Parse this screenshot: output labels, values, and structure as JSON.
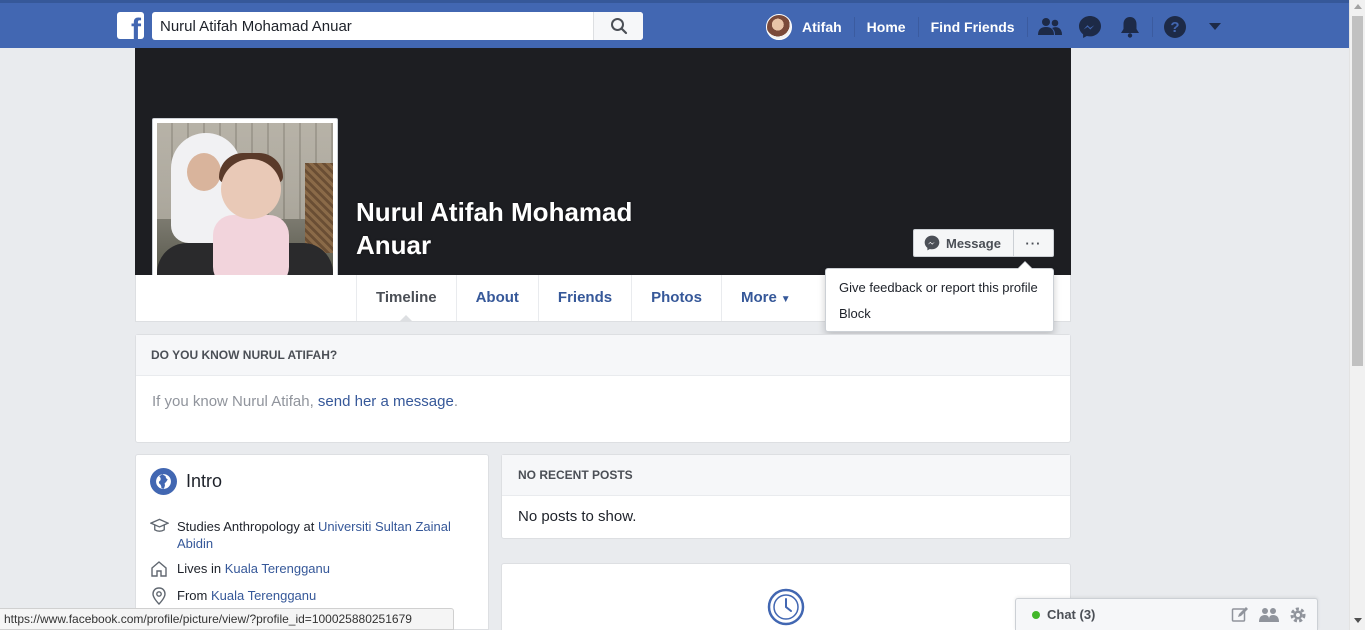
{
  "topbar": {
    "logo": "f",
    "search_value": "Nurul Atifah Mohamad Anuar",
    "user_name": "Atifah",
    "home": "Home",
    "find_friends": "Find Friends",
    "icons": [
      "friend-requests-icon",
      "messenger-icon",
      "notifications-icon",
      "help-icon",
      "account-menu-icon"
    ],
    "color": "#4267b2"
  },
  "profile": {
    "name": "Nurul Atifah Mohamad Anuar",
    "message_button": "Message",
    "more_button": "···"
  },
  "tabs": [
    {
      "label": "Timeline",
      "active": true
    },
    {
      "label": "About"
    },
    {
      "label": "Friends"
    },
    {
      "label": "Photos"
    },
    {
      "label": "More"
    }
  ],
  "dropdown": {
    "items": [
      "Give feedback or report this profile",
      "Block"
    ]
  },
  "know": {
    "heading": "DO YOU KNOW NURUL ATIFAH?",
    "text_prefix": "If you know Nurul Atifah, ",
    "link": "send her a message",
    "text_suffix": "."
  },
  "intro": {
    "title": "Intro",
    "studies_prefix": "Studies Anthropology at ",
    "studies_link": "Universiti Sultan Zainal Abidin",
    "lives_prefix": "Lives in ",
    "lives_link": "Kuala Terengganu",
    "from_prefix": "From ",
    "from_link": "Kuala Terengganu"
  },
  "posts": {
    "heading": "NO RECENT POSTS",
    "body": "No posts to show."
  },
  "statusbar": {
    "url": "https://www.facebook.com/profile/picture/view/?profile_id=100025880251679"
  },
  "chat": {
    "label": "Chat (3)",
    "online_color": "#42b72a"
  }
}
